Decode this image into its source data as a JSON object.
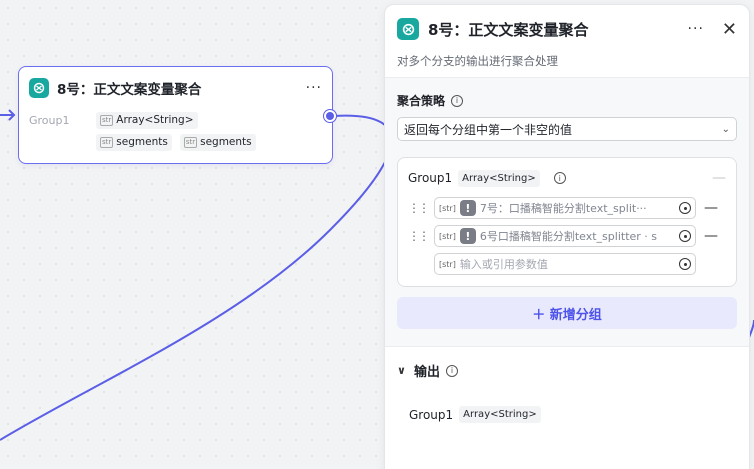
{
  "node": {
    "title": "8号：正文文案变量聚合",
    "more_icon": "more-icon",
    "group_label": "Group1",
    "group_type": "Array<String>",
    "item_1": "segments",
    "item_2": "segments",
    "str_icon_text": "str"
  },
  "panel": {
    "title": "8号：正文文案变量聚合",
    "description": "对多个分支的输出进行聚合处理",
    "strategy_label": "聚合策略",
    "strategy_value": "返回每个分组中第一个非空的值",
    "group_name": "Group1",
    "group_type": "Array<String>",
    "vars": [
      {
        "text": "7号：口播稿智能分割text_split···"
      },
      {
        "text": "6号口播稿智能分割text_splitter · s"
      }
    ],
    "placeholder": "输入或引用参数值",
    "add_group_label": "＋ 新增分组",
    "output_label": "输出",
    "output_name": "Group1",
    "output_type": "Array<String>"
  },
  "colors": {
    "accent": "#5b5ee6",
    "logo": "#18a8a0",
    "add_bg": "#e8e9fd",
    "add_text": "#4d53e8"
  }
}
